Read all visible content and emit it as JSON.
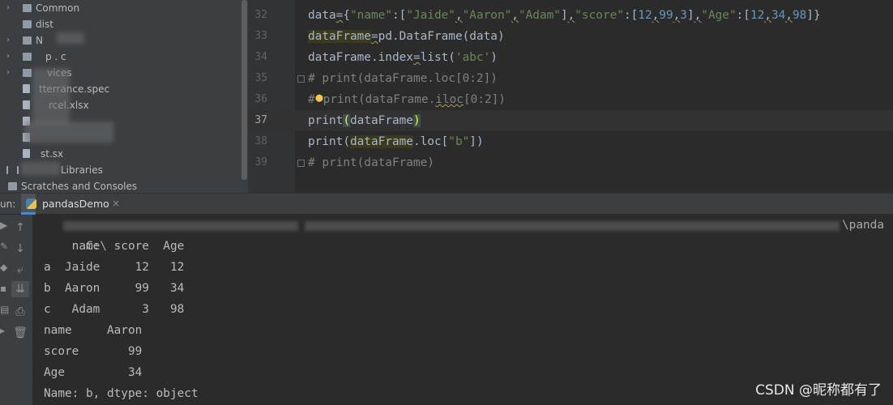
{
  "project_tree": {
    "items": [
      {
        "label": "Common",
        "icon": "folder-icon",
        "expand": "›"
      },
      {
        "label": "dist",
        "icon": "folder-icon",
        "expand": ""
      },
      {
        "label": "N",
        "icon": "folder-icon",
        "expand": "›"
      },
      {
        "label": "p . c",
        "icon": "folder-icon",
        "expand": "›"
      },
      {
        "label": "vices",
        "icon": "folder-icon",
        "expand": "›"
      },
      {
        "label": "tterrance.spec",
        "icon": "file-icon",
        "expand": ""
      },
      {
        "label": "rcel.xlsx",
        "icon": "file-icon",
        "expand": ""
      },
      {
        "label": "",
        "icon": "file-icon",
        "expand": ""
      },
      {
        "label": "",
        "icon": "file-icon",
        "expand": ""
      },
      {
        "label": "st.sx",
        "icon": "file-icon",
        "expand": ""
      },
      {
        "label": "Libraries",
        "icon": "library-icon",
        "expand": ""
      },
      {
        "label": "Scratches and Consoles",
        "icon": "scratches-icon",
        "expand": ""
      }
    ]
  },
  "editor": {
    "line_numbers": [
      "32",
      "33",
      "34",
      "35",
      "36",
      "37",
      "38",
      "39"
    ],
    "current_line": "37"
  },
  "run_panel": {
    "label": "un:",
    "tab_label": "pandasDemo",
    "tab_close": "×",
    "path_start": "C:\\",
    "path_end": "\\panda",
    "output": [
      "    name  score  Age",
      "a  Jaide     12   12",
      "b  Aaron     99   34",
      "c   Adam      3   98",
      "name     Aaron",
      "score       99",
      "Age         34",
      "Name: b, dtype: object"
    ]
  },
  "watermark": "CSDN @昵称都有了"
}
